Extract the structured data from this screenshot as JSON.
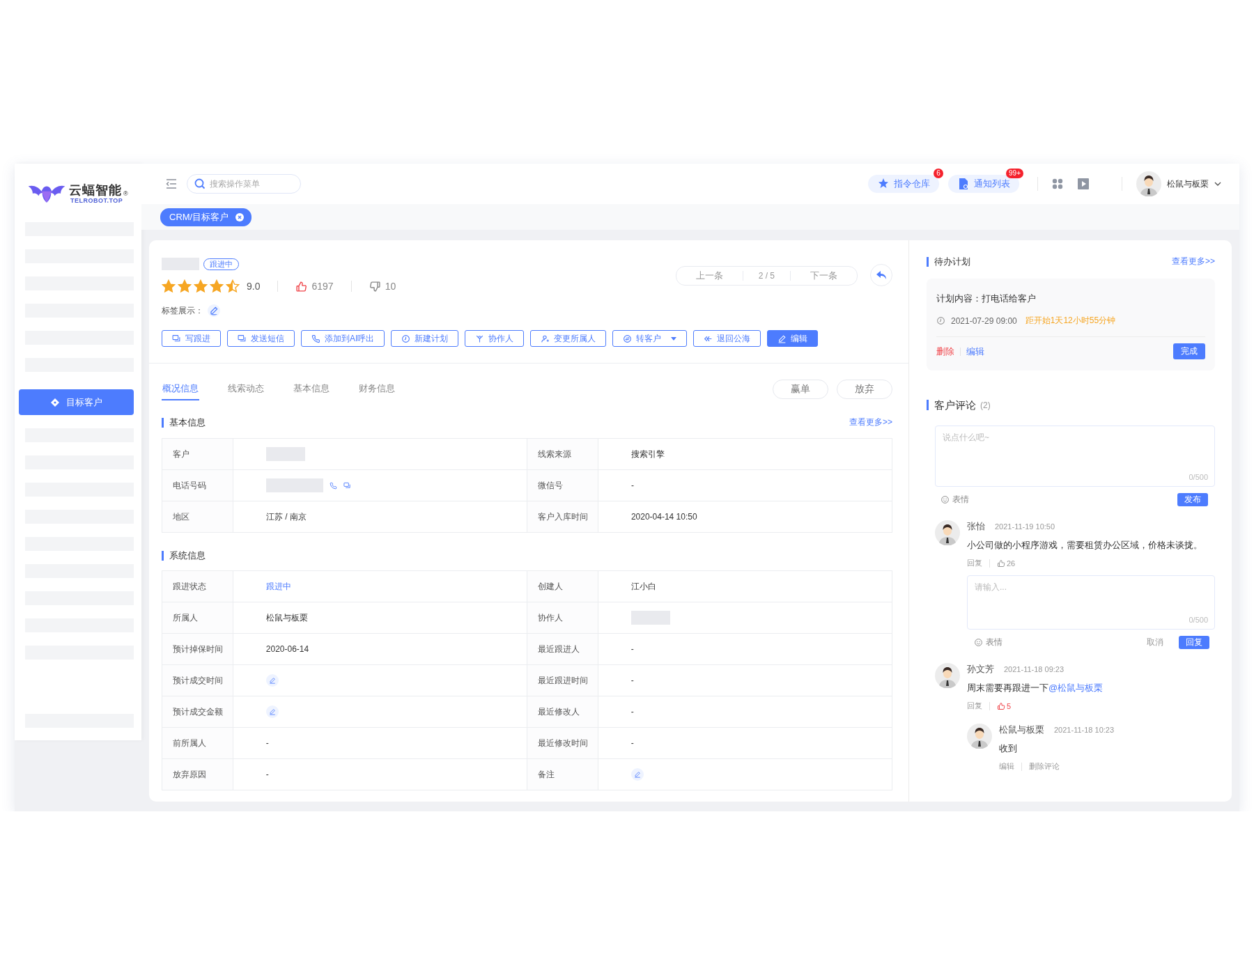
{
  "logo": {
    "name": "云蝠智能",
    "mark": "®",
    "domain": "TELROBOT.TOP"
  },
  "sidebar": {
    "items": [
      {
        "kind": "placeholder",
        "selected": false
      },
      {
        "kind": "placeholder",
        "selected": false
      },
      {
        "kind": "placeholder",
        "selected": false
      },
      {
        "kind": "placeholder",
        "selected": false
      },
      {
        "kind": "placeholder",
        "selected": false
      },
      {
        "kind": "placeholder",
        "selected": false
      },
      {
        "kind": "item",
        "label": "目标客户",
        "selected": true
      },
      {
        "kind": "placeholder",
        "selected": false
      },
      {
        "kind": "placeholder",
        "selected": false
      },
      {
        "kind": "placeholder",
        "selected": false
      },
      {
        "kind": "placeholder",
        "selected": false
      },
      {
        "kind": "placeholder",
        "selected": false
      },
      {
        "kind": "placeholder",
        "selected": false
      },
      {
        "kind": "placeholder",
        "selected": false
      },
      {
        "kind": "placeholder",
        "selected": false
      },
      {
        "kind": "placeholder",
        "selected": false
      },
      {
        "kind": "placeholder",
        "selected": false
      }
    ]
  },
  "header": {
    "search": {
      "placeholder": "搜索操作菜单"
    },
    "actions": [
      {
        "label": "指令仓库",
        "badge": "6"
      },
      {
        "label": "通知列表",
        "badge": "99+"
      }
    ],
    "user": {
      "name": "松鼠与板栗"
    }
  },
  "page_tabs": [
    {
      "label": "CRM/目标客户",
      "selected": true
    }
  ],
  "customer": {
    "status": "跟进中",
    "stars": 4.5,
    "score": "9.0",
    "likes": "6197",
    "liked": true,
    "dislikes": "10",
    "tags_label": "标签展示：",
    "pager": {
      "prev": "上一条",
      "position": "2 / 5",
      "next": "下一条"
    },
    "actions": [
      {
        "label": "写跟进",
        "primary": false,
        "dropdown": false
      },
      {
        "label": "发送短信",
        "primary": false,
        "dropdown": false
      },
      {
        "label": "添加到AI呼出",
        "primary": false,
        "dropdown": false
      },
      {
        "label": "新建计划",
        "primary": false,
        "dropdown": false
      },
      {
        "label": "协作人",
        "primary": false,
        "dropdown": false
      },
      {
        "label": "变更所属人",
        "primary": false,
        "dropdown": false
      },
      {
        "label": "转客户",
        "primary": false,
        "dropdown": true
      },
      {
        "label": "退回公海",
        "primary": false,
        "dropdown": false
      },
      {
        "label": "编辑",
        "primary": true,
        "dropdown": false
      }
    ]
  },
  "detail_tabs": [
    {
      "label": "概况信息",
      "selected": true
    },
    {
      "label": "线索动态",
      "selected": false
    },
    {
      "label": "基本信息",
      "selected": false
    },
    {
      "label": "财务信息",
      "selected": false
    }
  ],
  "outcome_buttons": [
    "赢单",
    "放弃"
  ],
  "sections": [
    {
      "title": "基本信息",
      "more": "查看更多>>",
      "rows": [
        [
          {
            "label": "客户",
            "kind": "redacted"
          },
          {
            "label": "线索来源",
            "kind": "text",
            "value": "搜索引擎"
          }
        ],
        [
          {
            "label": "电话号码",
            "kind": "phone"
          },
          {
            "label": "微信号",
            "kind": "text",
            "value": "-"
          }
        ],
        [
          {
            "label": "地区",
            "kind": "text",
            "value": "江苏 / 南京"
          },
          {
            "label": "客户入库时间",
            "kind": "text",
            "value": "2020-04-14 10:50"
          }
        ]
      ]
    },
    {
      "title": "系统信息",
      "rows": [
        [
          {
            "label": "跟进状态",
            "kind": "link",
            "value": "跟进中"
          },
          {
            "label": "创建人",
            "kind": "text",
            "value": "江小白"
          }
        ],
        [
          {
            "label": "所属人",
            "kind": "text",
            "value": "松鼠与板栗"
          },
          {
            "label": "协作人",
            "kind": "redacted"
          }
        ],
        [
          {
            "label": "预计掉保时间",
            "kind": "text",
            "value": "2020-06-14"
          },
          {
            "label": "最近跟进人",
            "kind": "text",
            "value": "-"
          }
        ],
        [
          {
            "label": "预计成交时间",
            "kind": "edit"
          },
          {
            "label": "最近跟进时间",
            "kind": "text",
            "value": "-"
          }
        ],
        [
          {
            "label": "预计成交金额",
            "kind": "edit"
          },
          {
            "label": "最近修改人",
            "kind": "text",
            "value": "-"
          }
        ],
        [
          {
            "label": "前所属人",
            "kind": "text",
            "value": "-"
          },
          {
            "label": "最近修改时间",
            "kind": "text",
            "value": "-"
          }
        ],
        [
          {
            "label": "放弃原因",
            "kind": "text",
            "value": "-"
          },
          {
            "label": "备注",
            "kind": "edit"
          }
        ]
      ]
    }
  ],
  "plan": {
    "title": "待办计划",
    "more": "查看更多>>",
    "content": "计划内容：打电话给客户",
    "time": "2021-07-29  09:00",
    "countdown": "距开始1天12小时55分钟",
    "delete": "删除",
    "edit": "编辑",
    "done": "完成"
  },
  "comments": {
    "title": "客户评论",
    "count": "(2)",
    "placeholder": "说点什么吧~",
    "counter": "0/500",
    "emoji": "表情",
    "submit": "发布",
    "items": [
      {
        "author": "张怡",
        "time": "2021-11-19 10:50",
        "text": "小公司做的小程序游戏，需要租赁办公区域，价格未谈拢。",
        "reply": "回复",
        "likes": "26",
        "liked": false,
        "reply_box": {
          "placeholder": "请输入...",
          "counter": "0/500",
          "emoji": "表情",
          "cancel": "取消",
          "submit": "回复"
        }
      },
      {
        "author": "孙文芳",
        "time": "2021-11-18 09:23",
        "text": "周末需要再跟进一下",
        "mention": "@松鼠与板栗",
        "reply": "回复",
        "likes": "5",
        "liked": true,
        "replies": [
          {
            "author": "松鼠与板栗",
            "time": "2021-11-18 10:23",
            "text": "收到",
            "actions": [
              "编辑",
              "删除评论"
            ]
          }
        ]
      }
    ]
  }
}
